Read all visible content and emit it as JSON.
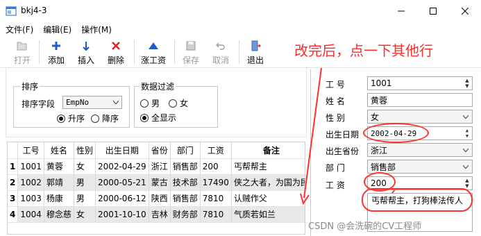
{
  "window": {
    "title": "bkj4-3"
  },
  "menu": [
    "文件(F)",
    "编辑(E)",
    "操作(M)"
  ],
  "toolbar": {
    "open": "打开",
    "add": "添加",
    "insert": "插入",
    "delete": "删除",
    "raise": "涨工资",
    "save": "保存",
    "cancel": "取消",
    "exit": "退出"
  },
  "annotation": "改完后，点一下其他行",
  "sort": {
    "group_title": "排序",
    "field_label": "排序字段",
    "field_value": "EmpNo",
    "asc": "升序",
    "desc": "降序"
  },
  "filter": {
    "group_title": "数据过滤",
    "male": "男",
    "female": "女",
    "all": "全显示"
  },
  "table": {
    "headers": [
      "工号",
      "姓名",
      "性别",
      "出生日期",
      "省份",
      "部门",
      "工资",
      "备注"
    ],
    "rows": [
      {
        "num": "1",
        "cells": [
          "1001",
          "黄蓉",
          "女",
          "2002-04-29",
          "浙江",
          "销售部",
          "200",
          "丐帮帮主"
        ]
      },
      {
        "num": "2",
        "cells": [
          "1002",
          "郭靖",
          "男",
          "2000-05-21",
          "蒙古",
          "技术部",
          "17490",
          "侠之大者，为国为民"
        ]
      },
      {
        "num": "3",
        "cells": [
          "1003",
          "杨康",
          "男",
          "2000-06-12",
          "陕西",
          "销售部",
          "7810",
          "认贼作父"
        ]
      },
      {
        "num": "4",
        "cells": [
          "1004",
          "穆念慈",
          "女",
          "2001-10-10",
          "吉林",
          "财务部",
          "7810",
          "气质若如兰"
        ]
      }
    ]
  },
  "detail": {
    "empno_label": "工    号",
    "empno_value": "1001",
    "name_label": "姓    名",
    "name_value": "黄蓉",
    "gender_label": "性    别",
    "gender_value": "女",
    "birth_label": "出生日期",
    "birth_value": "2002-04-29",
    "province_label": "出生省份",
    "province_value": "浙江",
    "dept_label": "部    门",
    "dept_value": "销售部",
    "salary_label": "工    资",
    "salary_value": "200",
    "memo_value": "丐帮帮主，打狗棒法传人"
  },
  "watermark": "CSDN @会洗碗的CV工程师",
  "colors": {
    "annotation": "#ff2a2a",
    "highlight_row": "#e8e8e8"
  }
}
